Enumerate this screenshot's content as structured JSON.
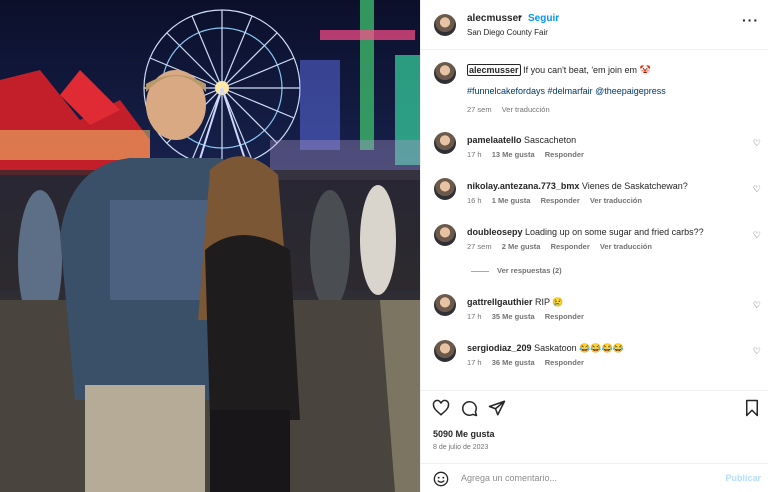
{
  "post": {
    "username": "alecmusser",
    "separator": "•",
    "follow_label": "Seguir",
    "location": "San Diego County Fair",
    "more_icon": "more-options-icon"
  },
  "caption": {
    "username": "alecmusser",
    "text": "If you can't beat, 'em join em 🤡",
    "hashtags": "#funnelcakefordays #delmarfair @theepaigepress",
    "time": "27 sem",
    "translate": "Ver traducción"
  },
  "comments": [
    {
      "user": "pamelaatello",
      "text": "Sascacheton",
      "time": "17 h",
      "likes": "13 Me gusta",
      "reply": "Responder",
      "translate": ""
    },
    {
      "user": "nikolay.antezana.773_bmx",
      "text": "Vienes de Saskatchewan?",
      "time": "16 h",
      "likes": "1 Me gusta",
      "reply": "Responder",
      "translate": "Ver traducción"
    },
    {
      "user": "doubleosepy",
      "text": "Loading up on some sugar and fried carbs??",
      "time": "27 sem",
      "likes": "2 Me gusta",
      "reply": "Responder",
      "translate": "Ver traducción"
    },
    {
      "user": "gattrellgauthier",
      "text": "RIP 😢",
      "time": "17 h",
      "likes": "35 Me gusta",
      "reply": "Responder",
      "translate": ""
    },
    {
      "user": "sergiodiaz_209",
      "text": "Saskatoon 😂😂😂😂",
      "time": "17 h",
      "likes": "36 Me gusta",
      "reply": "Responder",
      "translate": ""
    }
  ],
  "view_replies": "Ver respuestas (2)",
  "footer": {
    "likes": "5090 Me gusta",
    "date": "8 de julio de 2023",
    "comment_placeholder": "Agrega un comentario...",
    "post_label": "Publicar"
  },
  "colors": {
    "link": "#0095f6",
    "hashtag": "#00376b",
    "muted": "#737373"
  }
}
